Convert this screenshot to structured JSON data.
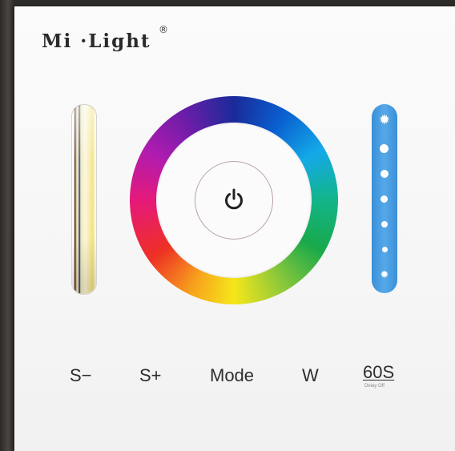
{
  "brand": {
    "logo_text": "Mi ·Light",
    "registered_mark": "®"
  },
  "controls": {
    "power_icon": "power-icon",
    "saturation_bar_icon": "white-balance-slider",
    "brightness_bar_icon": "brightness-slider",
    "color_wheel_icon": "rgb-color-wheel"
  },
  "buttons": {
    "s_minus": "S−",
    "s_plus": "S+",
    "mode": "Mode",
    "w": "W",
    "delay": "60S",
    "delay_sub": "Delay Off"
  },
  "colors": {
    "panel": "#f6f6f6",
    "brightness_bar": "#4a9de0",
    "text": "#2d2d2d"
  }
}
